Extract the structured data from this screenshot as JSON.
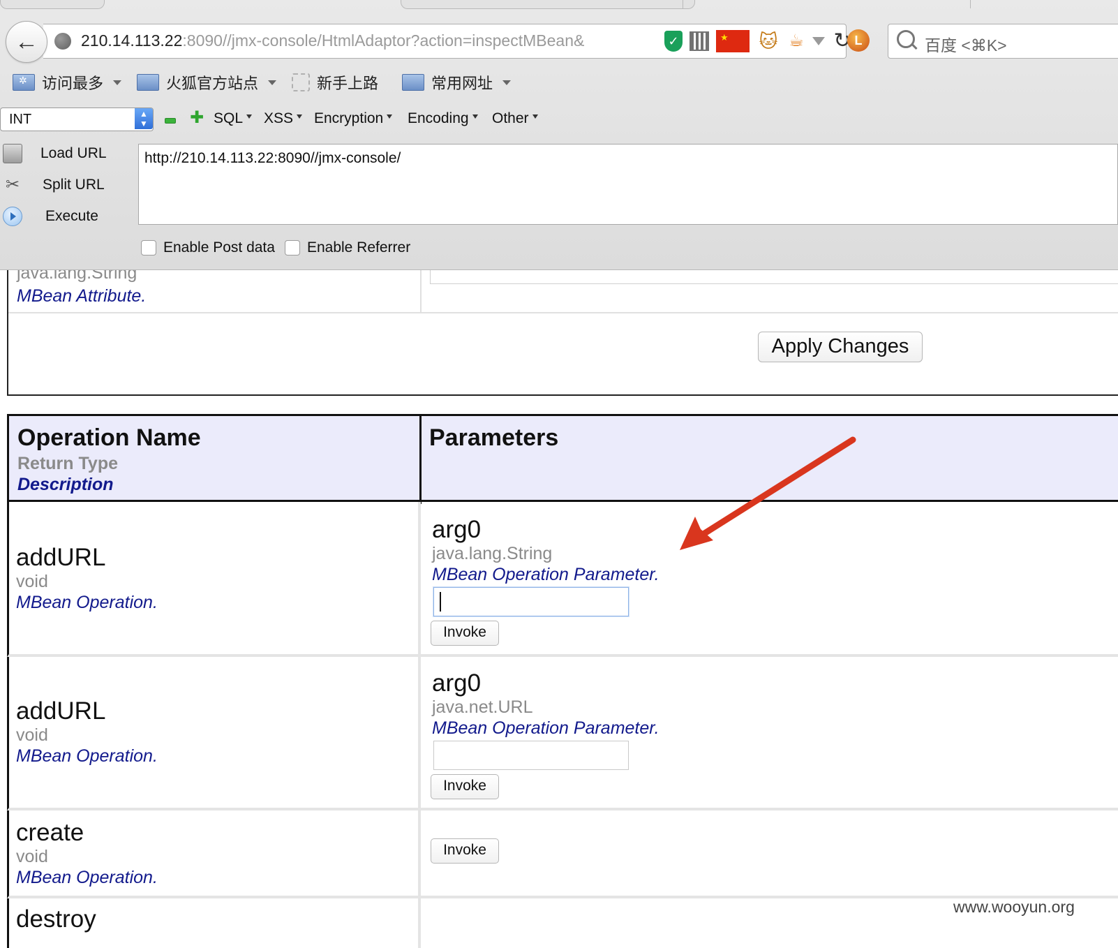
{
  "browser": {
    "url_host": "210.14.113.22",
    "url_rest": ":8090//jmx-console/HtmlAdaptor?action=inspectMBean&",
    "search_placeholder": "百度 <⌘K>",
    "bookmarks": [
      "访问最多",
      "火狐官方站点",
      "新手上路",
      "常用网址"
    ]
  },
  "hackbar": {
    "select_value": "INT",
    "menus": [
      "SQL",
      "XSS",
      "Encryption",
      "Encoding",
      "Other"
    ],
    "actions": [
      "Load URL",
      "Split URL",
      "Execute"
    ],
    "url_value": "http://210.14.113.22:8090//jmx-console/",
    "checkbox_post": "Enable Post data",
    "checkbox_referrer": "Enable Referrer"
  },
  "attribute": {
    "type": "java.lang.String",
    "description": "MBean Attribute.",
    "apply_label": "Apply Changes"
  },
  "operations_header": {
    "name": "Operation Name",
    "return_type": "Return Type",
    "description": "Description",
    "parameters": "Parameters"
  },
  "operations": [
    {
      "name": "addURL",
      "return": "void",
      "desc": "MBean Operation.",
      "param_name": "arg0",
      "param_type": "java.lang.String",
      "param_desc": "MBean Operation Parameter.",
      "invoke": "Invoke"
    },
    {
      "name": "addURL",
      "return": "void",
      "desc": "MBean Operation.",
      "param_name": "arg0",
      "param_type": "java.net.URL",
      "param_desc": "MBean Operation Parameter.",
      "invoke": "Invoke"
    },
    {
      "name": "create",
      "return": "void",
      "desc": "MBean Operation.",
      "invoke": "Invoke"
    },
    {
      "name": "destroy"
    }
  ],
  "watermark": "www.wooyun.org",
  "colors": {
    "annotation_arrow": "#d9361e",
    "description_text": "#121a8c",
    "header_bg": "#ebebfb"
  }
}
